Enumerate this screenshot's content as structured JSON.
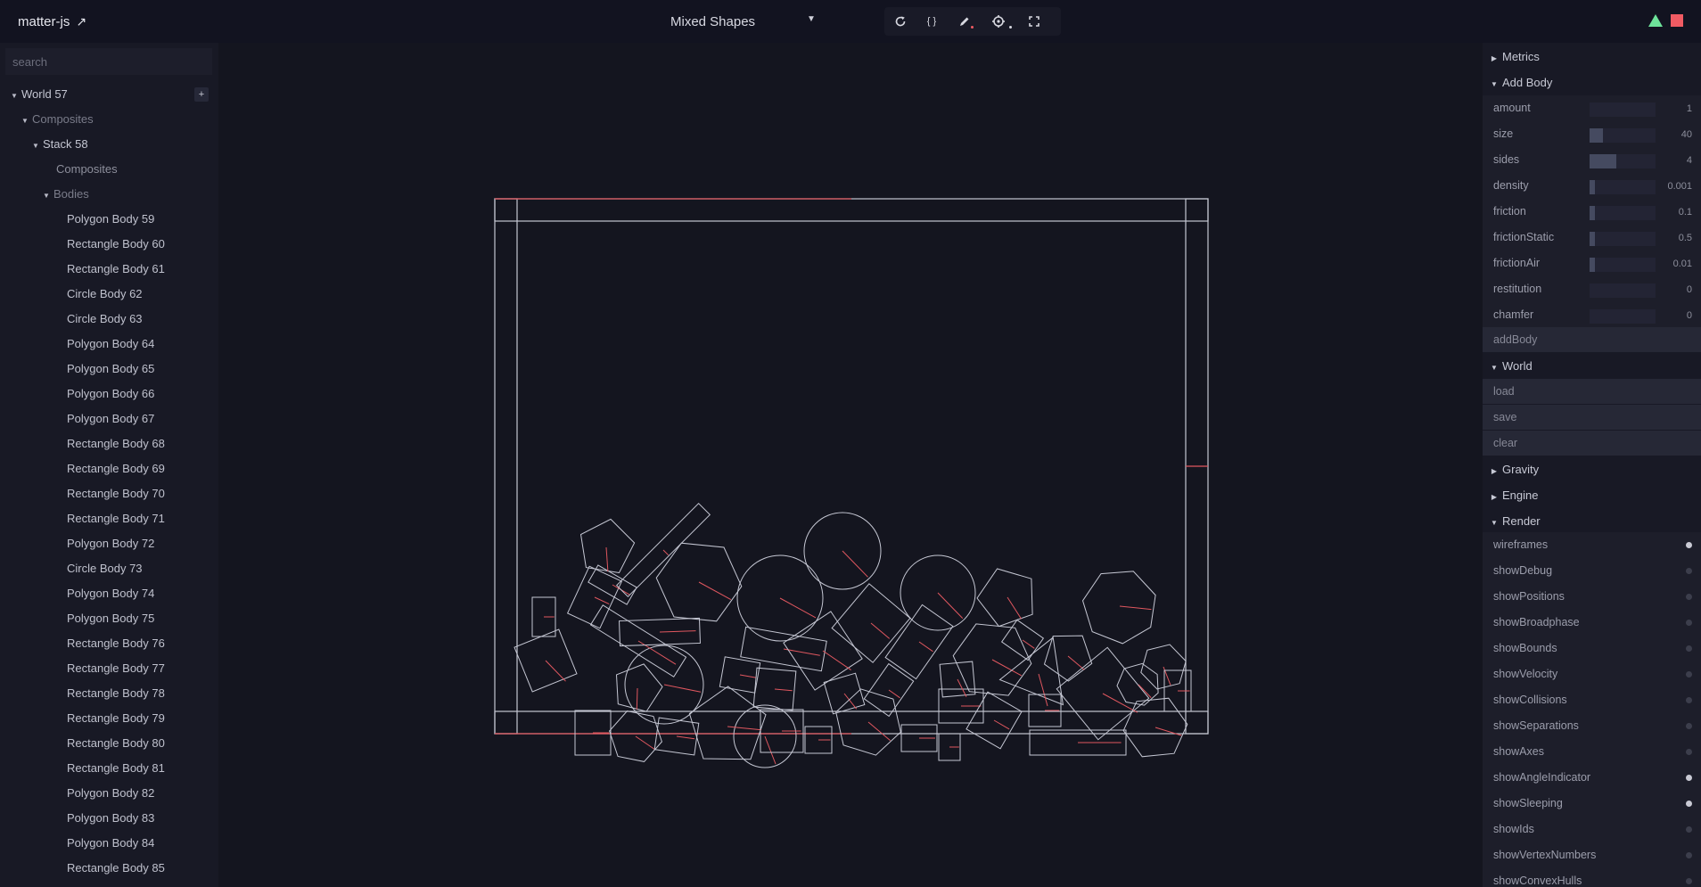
{
  "topbar": {
    "brand": "matter-js",
    "brand_arrow": "↗",
    "example_selected": "Mixed Shapes",
    "status_colors": [
      "#6ee39a",
      "#f05b63"
    ]
  },
  "toolbar": {
    "icons": [
      "reset-icon",
      "code-icon",
      "pencil-icon",
      "gear-icon",
      "fullscreen-icon"
    ],
    "code_glyph": "{ }"
  },
  "left_panel": {
    "search_placeholder": "search",
    "world_label": "World 57",
    "world_add": "+",
    "composites_label": "Composites",
    "stack_label": "Stack 58",
    "stack_composites_label": "Composites",
    "bodies_label": "Bodies",
    "bodies": [
      "Polygon Body 59",
      "Rectangle Body 60",
      "Rectangle Body 61",
      "Circle Body 62",
      "Circle Body 63",
      "Polygon Body 64",
      "Polygon Body 65",
      "Polygon Body 66",
      "Polygon Body 67",
      "Rectangle Body 68",
      "Rectangle Body 69",
      "Rectangle Body 70",
      "Rectangle Body 71",
      "Polygon Body 72",
      "Circle Body 73",
      "Polygon Body 74",
      "Polygon Body 75",
      "Rectangle Body 76",
      "Rectangle Body 77",
      "Rectangle Body 78",
      "Rectangle Body 79",
      "Rectangle Body 80",
      "Rectangle Body 81",
      "Polygon Body 82",
      "Polygon Body 83",
      "Polygon Body 84",
      "Rectangle Body 85"
    ]
  },
  "right_panel": {
    "metrics_label": "Metrics",
    "add_body_label": "Add Body",
    "add_body_props": [
      {
        "label": "amount",
        "value": "1",
        "fill": 0.0
      },
      {
        "label": "size",
        "value": "40",
        "fill": 0.2
      },
      {
        "label": "sides",
        "value": "4",
        "fill": 0.41
      },
      {
        "label": "density",
        "value": "0.001",
        "fill": 0.06
      },
      {
        "label": "friction",
        "value": "0.1",
        "fill": 0.06
      },
      {
        "label": "frictionStatic",
        "value": "0.5",
        "fill": 0.04
      },
      {
        "label": "frictionAir",
        "value": "0.01",
        "fill": 0.07
      },
      {
        "label": "restitution",
        "value": "0",
        "fill": 0.0
      },
      {
        "label": "chamfer",
        "value": "0",
        "fill": 0.0
      }
    ],
    "add_body_button": "addBody",
    "world_label": "World",
    "world_buttons": [
      "load",
      "save",
      "clear"
    ],
    "gravity_label": "Gravity",
    "engine_label": "Engine",
    "render_label": "Render",
    "render_toggles": [
      {
        "label": "wireframes",
        "on": true
      },
      {
        "label": "showDebug",
        "on": false
      },
      {
        "label": "showPositions",
        "on": false
      },
      {
        "label": "showBroadphase",
        "on": false
      },
      {
        "label": "showBounds",
        "on": false
      },
      {
        "label": "showVelocity",
        "on": false
      },
      {
        "label": "showCollisions",
        "on": false
      },
      {
        "label": "showSeparations",
        "on": false
      },
      {
        "label": "showAxes",
        "on": false
      },
      {
        "label": "showAngleIndicator",
        "on": true
      },
      {
        "label": "showSleeping",
        "on": true
      },
      {
        "label": "showIds",
        "on": false
      },
      {
        "label": "showVertexNumbers",
        "on": false
      },
      {
        "label": "showConvexHulls",
        "on": false
      }
    ]
  },
  "scene": {
    "wireframe_color": "#c5c7d3",
    "indicator_color": "#e0575f"
  }
}
